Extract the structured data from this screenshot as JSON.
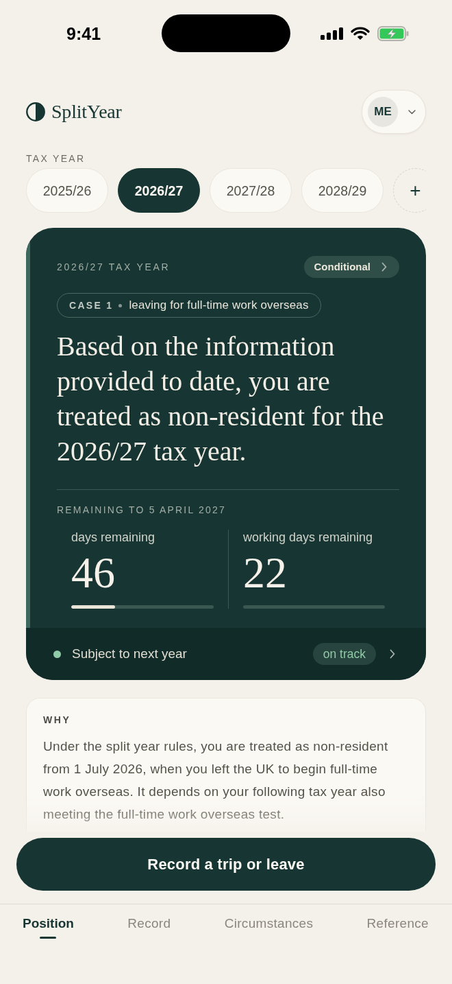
{
  "status_bar": {
    "time": "9:41"
  },
  "header": {
    "app_name": "SplitYear",
    "profile": {
      "initials": "ME"
    }
  },
  "tax_year": {
    "label": "TAX YEAR",
    "years": [
      {
        "label": "2025/26",
        "selected": false
      },
      {
        "label": "2026/27",
        "selected": true
      },
      {
        "label": "2027/28",
        "selected": false
      },
      {
        "label": "2028/29",
        "selected": false
      }
    ],
    "add_label": "+"
  },
  "summary_card": {
    "eyebrow": "2026/27 TAX YEAR",
    "status_button": "Conditional",
    "case": {
      "number": "CASE 1",
      "description": "leaving for full-time work overseas"
    },
    "headline": "Based on the information provided to date, you are treated as non-resident for the 2026/27 tax year.",
    "remaining_label": "REMAINING TO 5 APRIL 2027",
    "stats": [
      {
        "label": "days remaining",
        "value": "46",
        "level": 0.31
      },
      {
        "label": "working days remaining",
        "value": "22"
      }
    ],
    "footer": {
      "label": "Subject to next year",
      "status": "on track"
    }
  },
  "why": {
    "heading": "WHY",
    "text": "Under the split year rules, you are treated as non-resident from 1 July 2026, when you left the UK to begin full-time work overseas. It depends on your following tax year also meeting the full-time work overseas test."
  },
  "primary_button": "Record a trip or leave",
  "bottom_tabs": [
    {
      "label": "Position",
      "selected": true
    },
    {
      "label": "Record",
      "selected": false
    },
    {
      "label": "Circumstances",
      "selected": false
    },
    {
      "label": "Reference",
      "selected": false
    }
  ]
}
